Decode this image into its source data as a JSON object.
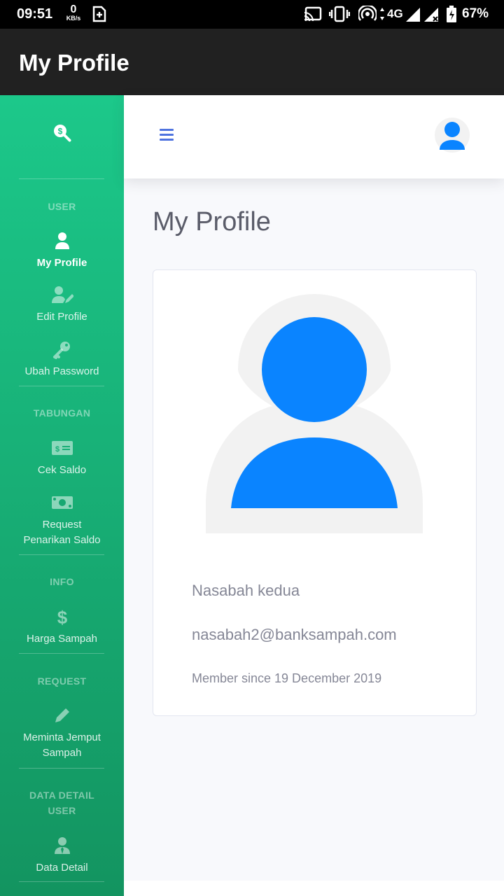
{
  "status_bar": {
    "time": "09:51",
    "net_speed_value": "0",
    "net_speed_unit": "KB/s",
    "network_type": "4G",
    "battery": "67%"
  },
  "app_bar": {
    "title": "My Profile"
  },
  "sidebar": {
    "headings": {
      "user": "USER",
      "tabungan": "TABUNGAN",
      "info": "INFO",
      "request": "REQUEST",
      "data_detail_1": "DATA DETAIL",
      "data_detail_2": "USER"
    },
    "items": {
      "my_profile": "My Profile",
      "edit_profile": "Edit Profile",
      "ubah_password": "Ubah Password",
      "cek_saldo": "Cek Saldo",
      "request_penarikan_1": "Request",
      "request_penarikan_2": "Penarikan Saldo",
      "harga_sampah": "Harga Sampah",
      "meminta_jemput_1": "Meminta Jemput",
      "meminta_jemput_2": "Sampah",
      "data_detail": "Data Detail"
    }
  },
  "main": {
    "page_title": "My Profile",
    "profile": {
      "name": "Nasabah kedua",
      "email": "nasabah2@banksampah.com",
      "member_since": "Member since 19 December 2019"
    }
  },
  "colors": {
    "sidebar_top": "#1cc88a",
    "sidebar_bottom": "#139460",
    "avatar_blue": "#0a84ff",
    "hamburger": "#4e73df"
  }
}
